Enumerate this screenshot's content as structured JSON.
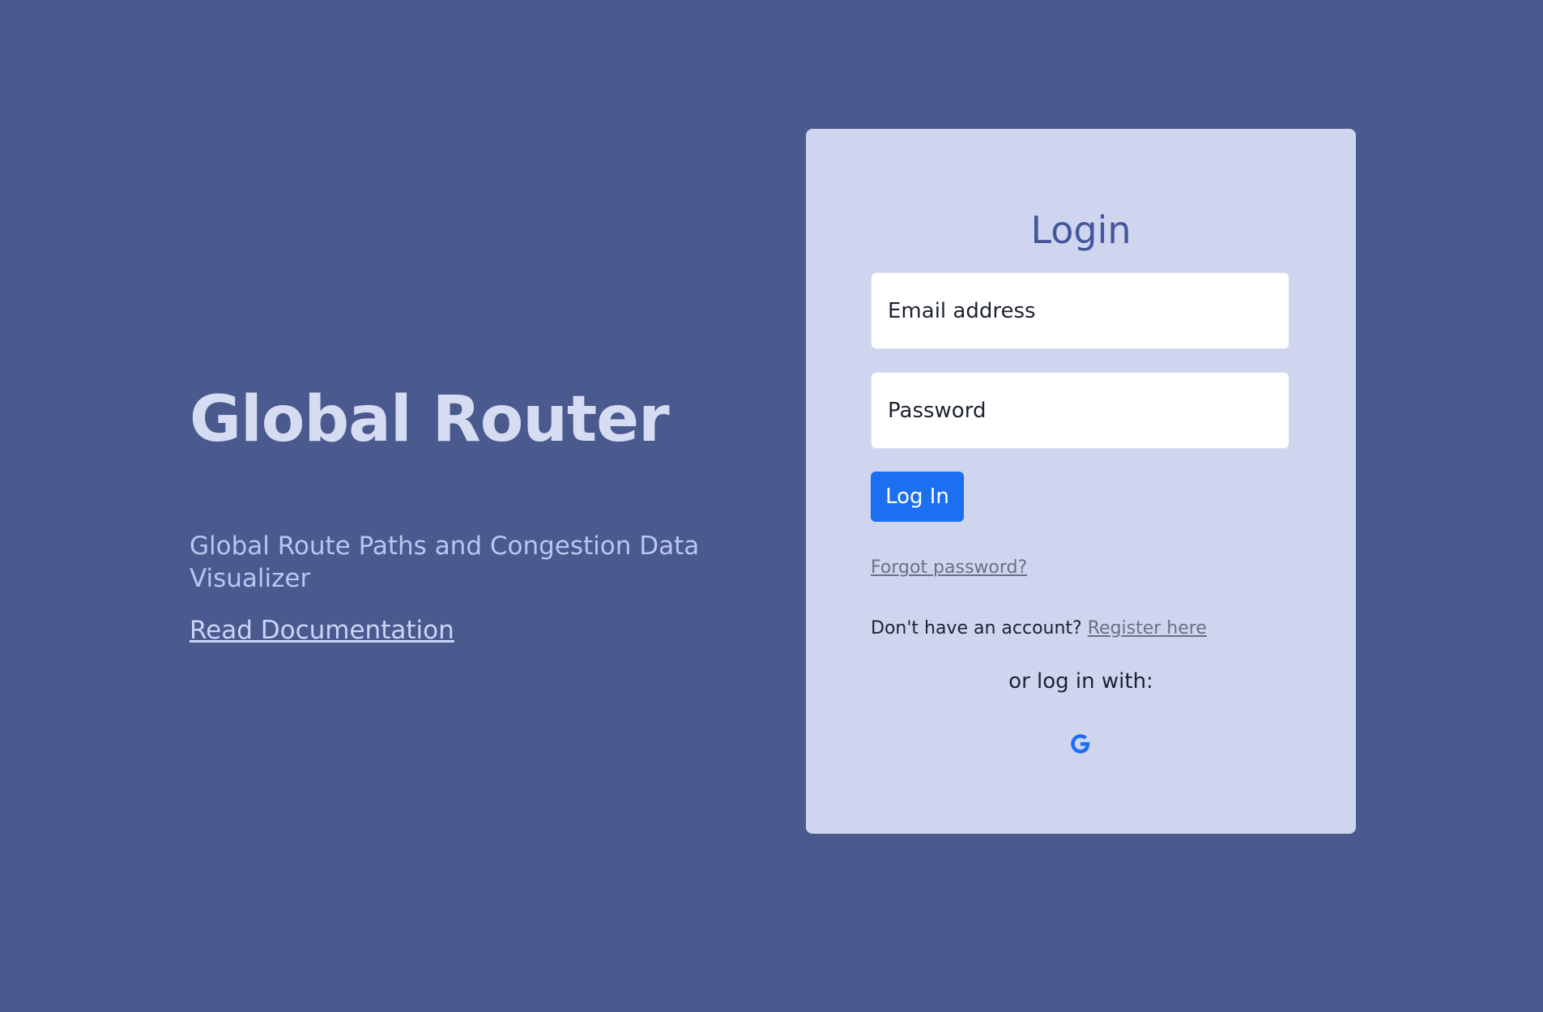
{
  "hero": {
    "title": "Global Router",
    "subtitle": "Global Route Paths and Congestion Data Visualizer",
    "docs_link": "Read Documentation"
  },
  "login": {
    "title": "Login",
    "email_label": "Email address",
    "password_label": "Password",
    "submit_label": "Log In",
    "forgot_link": "Forgot password?",
    "no_account_text": "Don't have an account?",
    "register_link": "Register here",
    "alt_login_text": "or log in with:",
    "alt_providers": [
      {
        "icon": "google-icon",
        "color": "#1d6ff2"
      }
    ]
  },
  "colors": {
    "background": "#4a5a8f",
    "card": "#cfd5ef",
    "accent": "#1d6ff2"
  }
}
